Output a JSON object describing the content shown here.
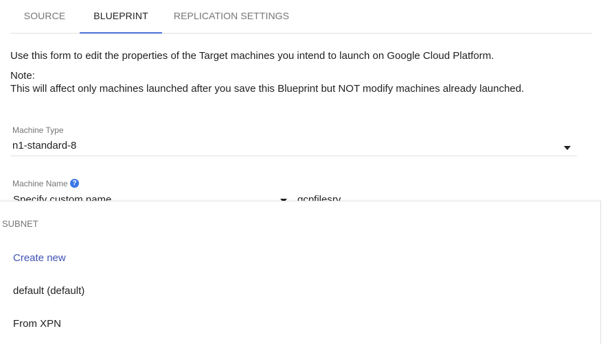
{
  "tabs": [
    {
      "label": "SOURCE"
    },
    {
      "label": "BLUEPRINT"
    },
    {
      "label": "REPLICATION SETTINGS"
    }
  ],
  "active_tab": "BLUEPRINT",
  "intro": "Use this form to edit the properties of the Target machines you intend to launch on Google Cloud Platform.",
  "note_title": "Note:",
  "note_body": "This will affect only machines launched after you save this Blueprint but NOT modify machines already launched.",
  "machine_type": {
    "label": "Machine Type",
    "value": "n1-standard-8"
  },
  "machine_name": {
    "label": "Machine Name",
    "help_glyph": "?",
    "mode": "Specify custom name",
    "value": "gcpfilesrv"
  },
  "subnet_menu": {
    "header": "SUBNET",
    "items": [
      {
        "label": "Create new"
      },
      {
        "label": "default (default)"
      },
      {
        "label": "From XPN"
      }
    ]
  },
  "colors": {
    "accent": "#4a6fd8",
    "link": "#3f51b5",
    "help_icon": "#3b78e7"
  }
}
